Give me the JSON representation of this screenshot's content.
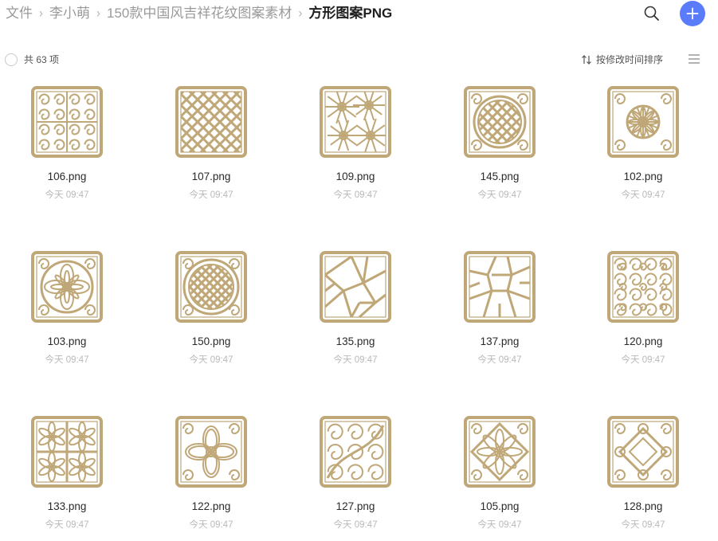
{
  "breadcrumb": {
    "items": [
      "文件",
      "李小萌",
      "150款中国风吉祥花纹图案素材"
    ],
    "current": "方形图案PNG",
    "separator": "›"
  },
  "toolbar": {
    "count_label": "共 63 项",
    "sort_label": "按修改时间排序"
  },
  "colors": {
    "accent": "#5b7cfa",
    "pattern": "#bfa777"
  },
  "files": [
    {
      "name": "106.png",
      "date": "今天 09:47",
      "pattern": "scroll-tile"
    },
    {
      "name": "107.png",
      "date": "今天 09:47",
      "pattern": "lattice-diagonal"
    },
    {
      "name": "109.png",
      "date": "今天 09:47",
      "pattern": "flower-burst"
    },
    {
      "name": "145.png",
      "date": "今天 09:47",
      "pattern": "circle-knot"
    },
    {
      "name": "102.png",
      "date": "今天 09:47",
      "pattern": "sun-medallion"
    },
    {
      "name": "103.png",
      "date": "今天 09:47",
      "pattern": "ring-flower"
    },
    {
      "name": "150.png",
      "date": "今天 09:47",
      "pattern": "circle-knot-2"
    },
    {
      "name": "135.png",
      "date": "今天 09:47",
      "pattern": "cracked-ice"
    },
    {
      "name": "137.png",
      "date": "今天 09:47",
      "pattern": "cracked-ice-2"
    },
    {
      "name": "120.png",
      "date": "今天 09:47",
      "pattern": "cloud-scroll"
    },
    {
      "name": "133.png",
      "date": "今天 09:47",
      "pattern": "star-lattice"
    },
    {
      "name": "122.png",
      "date": "今天 09:47",
      "pattern": "four-petal"
    },
    {
      "name": "127.png",
      "date": "今天 09:47",
      "pattern": "vine-scroll"
    },
    {
      "name": "105.png",
      "date": "今天 09:47",
      "pattern": "lotus-diamond"
    },
    {
      "name": "128.png",
      "date": "今天 09:47",
      "pattern": "ribbon-knot"
    }
  ]
}
